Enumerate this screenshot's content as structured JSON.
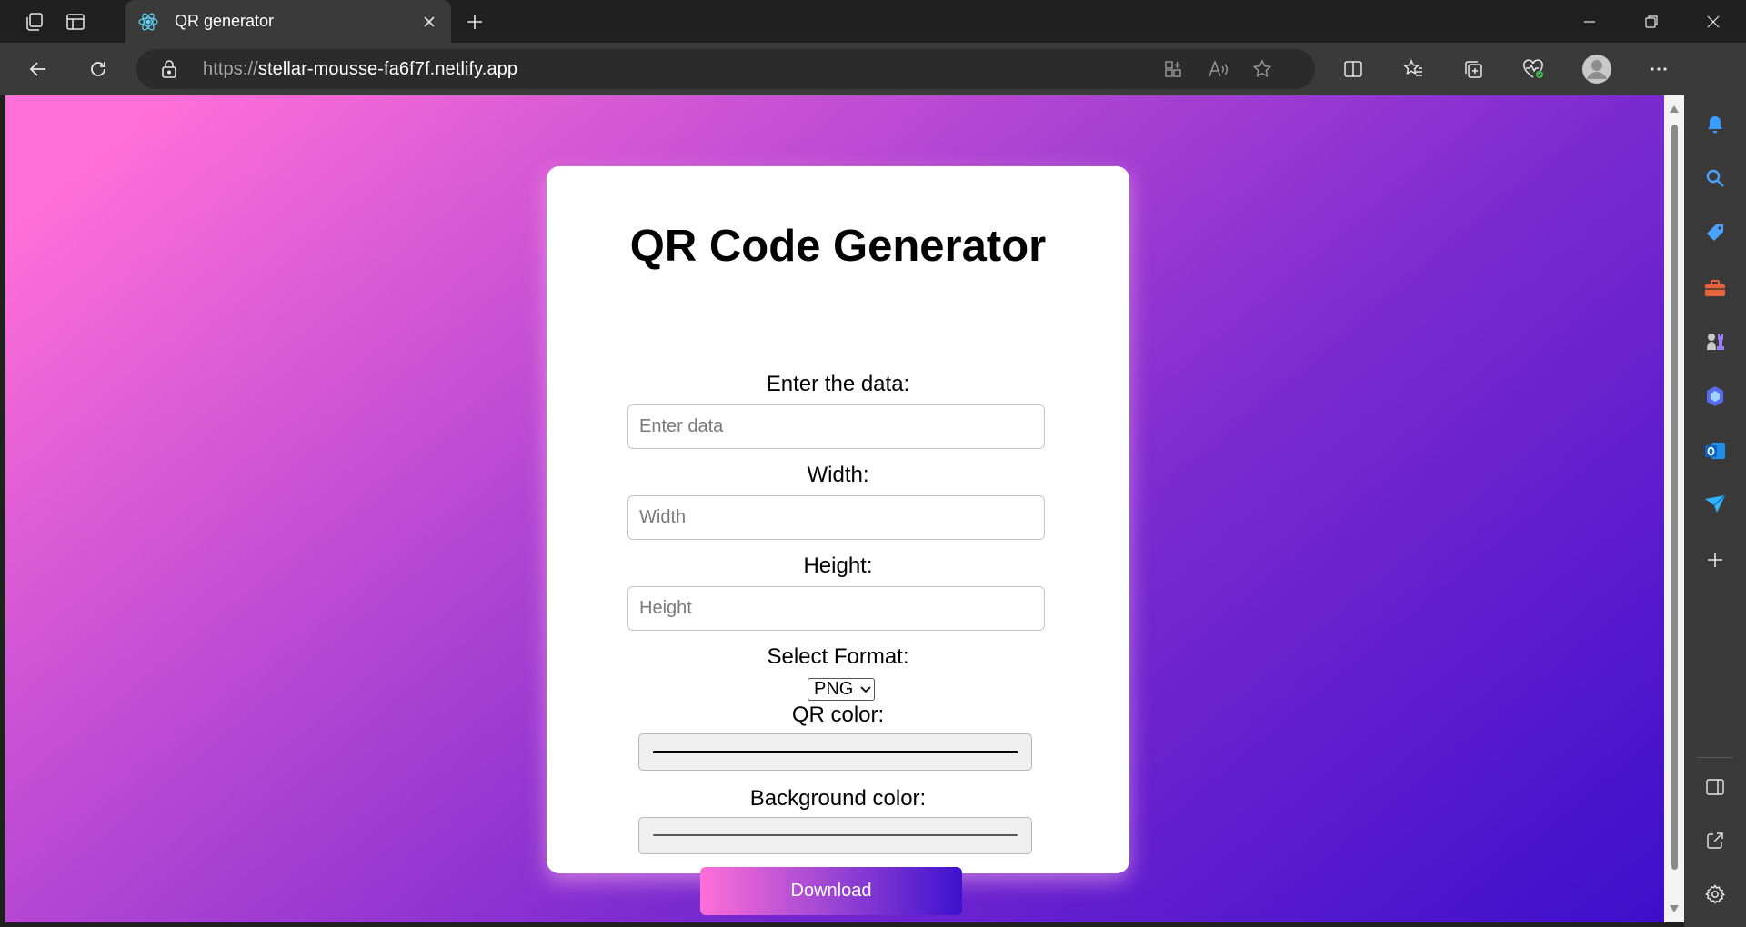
{
  "tab": {
    "title": "QR generator",
    "favicon": "react-atom-icon"
  },
  "address": {
    "protocol": "https://",
    "host": "stellar-mousse-fa6f7f.netlify.app"
  },
  "page": {
    "title": "QR Code Generator",
    "data_label": "Enter the data:",
    "data_placeholder": "Enter data",
    "width_label": "Width:",
    "width_placeholder": "Width",
    "height_label": "Height:",
    "height_placeholder": "Height",
    "format_label": "Select Format:",
    "format_value": "PNG",
    "qr_color_label": "QR color:",
    "qr_color_value": "#000000",
    "bg_color_label": "Background color:",
    "bg_color_value": "#ffffff",
    "download_label": "Download"
  },
  "colors": {
    "gradient_start": "#ff6fd8",
    "gradient_end": "#3d0ecb"
  },
  "sidebar_icons": [
    "bell-icon",
    "search-icon",
    "tag-icon",
    "toolbox-icon",
    "chess-icon",
    "copilot-icon",
    "outlook-icon",
    "send-icon",
    "plus-icon",
    "split-panel-icon",
    "external-link-icon",
    "settings-icon"
  ]
}
